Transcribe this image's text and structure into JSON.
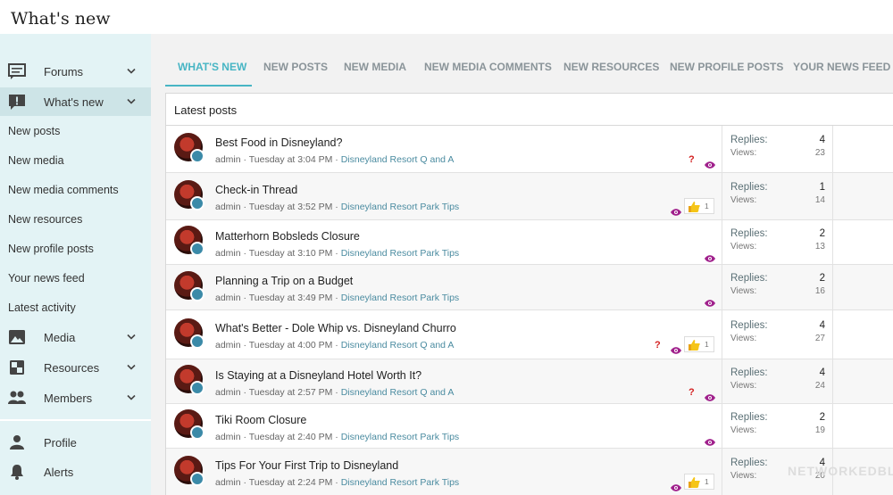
{
  "page": {
    "title": "What's new"
  },
  "sidebar": {
    "forums": "Forums",
    "whats_new": "What's new",
    "links": [
      "New posts",
      "New media",
      "New media comments",
      "New resources",
      "New profile posts",
      "Your news feed",
      "Latest activity"
    ],
    "media": "Media",
    "resources": "Resources",
    "members": "Members",
    "profile": "Profile",
    "alerts": "Alerts"
  },
  "tabs": [
    "WHAT'S NEW",
    "NEW POSTS",
    "NEW MEDIA",
    "NEW MEDIA COMMENTS",
    "NEW RESOURCES",
    "NEW PROFILE POSTS",
    "YOUR NEWS FEED"
  ],
  "panel": {
    "heading": "Latest posts",
    "replies_label": "Replies:",
    "views_label": "Views:"
  },
  "colors": {
    "accent": "#47b5c4",
    "question": "#d32020",
    "watched": "#a0208c",
    "forum_link": "#4a8ba0"
  },
  "threads": [
    {
      "title": "Best Food in Disneyland?",
      "author": "admin",
      "date": "Tuesday at 3:04 PM",
      "forum": "Disneyland Resort Q and A",
      "replies": "4",
      "views": "23",
      "question": true,
      "watched": true,
      "likes": ""
    },
    {
      "title": "Check-in Thread",
      "author": "admin",
      "date": "Tuesday at 3:52 PM",
      "forum": "Disneyland Resort Park Tips",
      "replies": "1",
      "views": "14",
      "question": false,
      "watched": true,
      "likes": "1"
    },
    {
      "title": "Matterhorn Bobsleds Closure",
      "author": "admin",
      "date": "Tuesday at 3:10 PM",
      "forum": "Disneyland Resort Park Tips",
      "replies": "2",
      "views": "13",
      "question": false,
      "watched": true,
      "likes": ""
    },
    {
      "title": "Planning a Trip on a Budget",
      "author": "admin",
      "date": "Tuesday at 3:49 PM",
      "forum": "Disneyland Resort Park Tips",
      "replies": "2",
      "views": "16",
      "question": false,
      "watched": true,
      "likes": ""
    },
    {
      "title": "What's Better - Dole Whip vs. Disneyland Churro",
      "author": "admin",
      "date": "Tuesday at 4:00 PM",
      "forum": "Disneyland Resort Q and A",
      "replies": "4",
      "views": "27",
      "question": true,
      "watched": true,
      "likes": "1"
    },
    {
      "title": "Is Staying at a Disneyland Hotel Worth It?",
      "author": "admin",
      "date": "Tuesday at 2:57 PM",
      "forum": "Disneyland Resort Q and A",
      "replies": "4",
      "views": "24",
      "question": true,
      "watched": true,
      "likes": ""
    },
    {
      "title": "Tiki Room Closure",
      "author": "admin",
      "date": "Tuesday at 2:40 PM",
      "forum": "Disneyland Resort Park Tips",
      "replies": "2",
      "views": "19",
      "question": false,
      "watched": true,
      "likes": ""
    },
    {
      "title": "Tips For Your First Trip to Disneyland",
      "author": "admin",
      "date": "Tuesday at 2:24 PM",
      "forum": "Disneyland Resort Park Tips",
      "replies": "4",
      "views": "20",
      "question": false,
      "watched": true,
      "likes": "1"
    }
  ]
}
